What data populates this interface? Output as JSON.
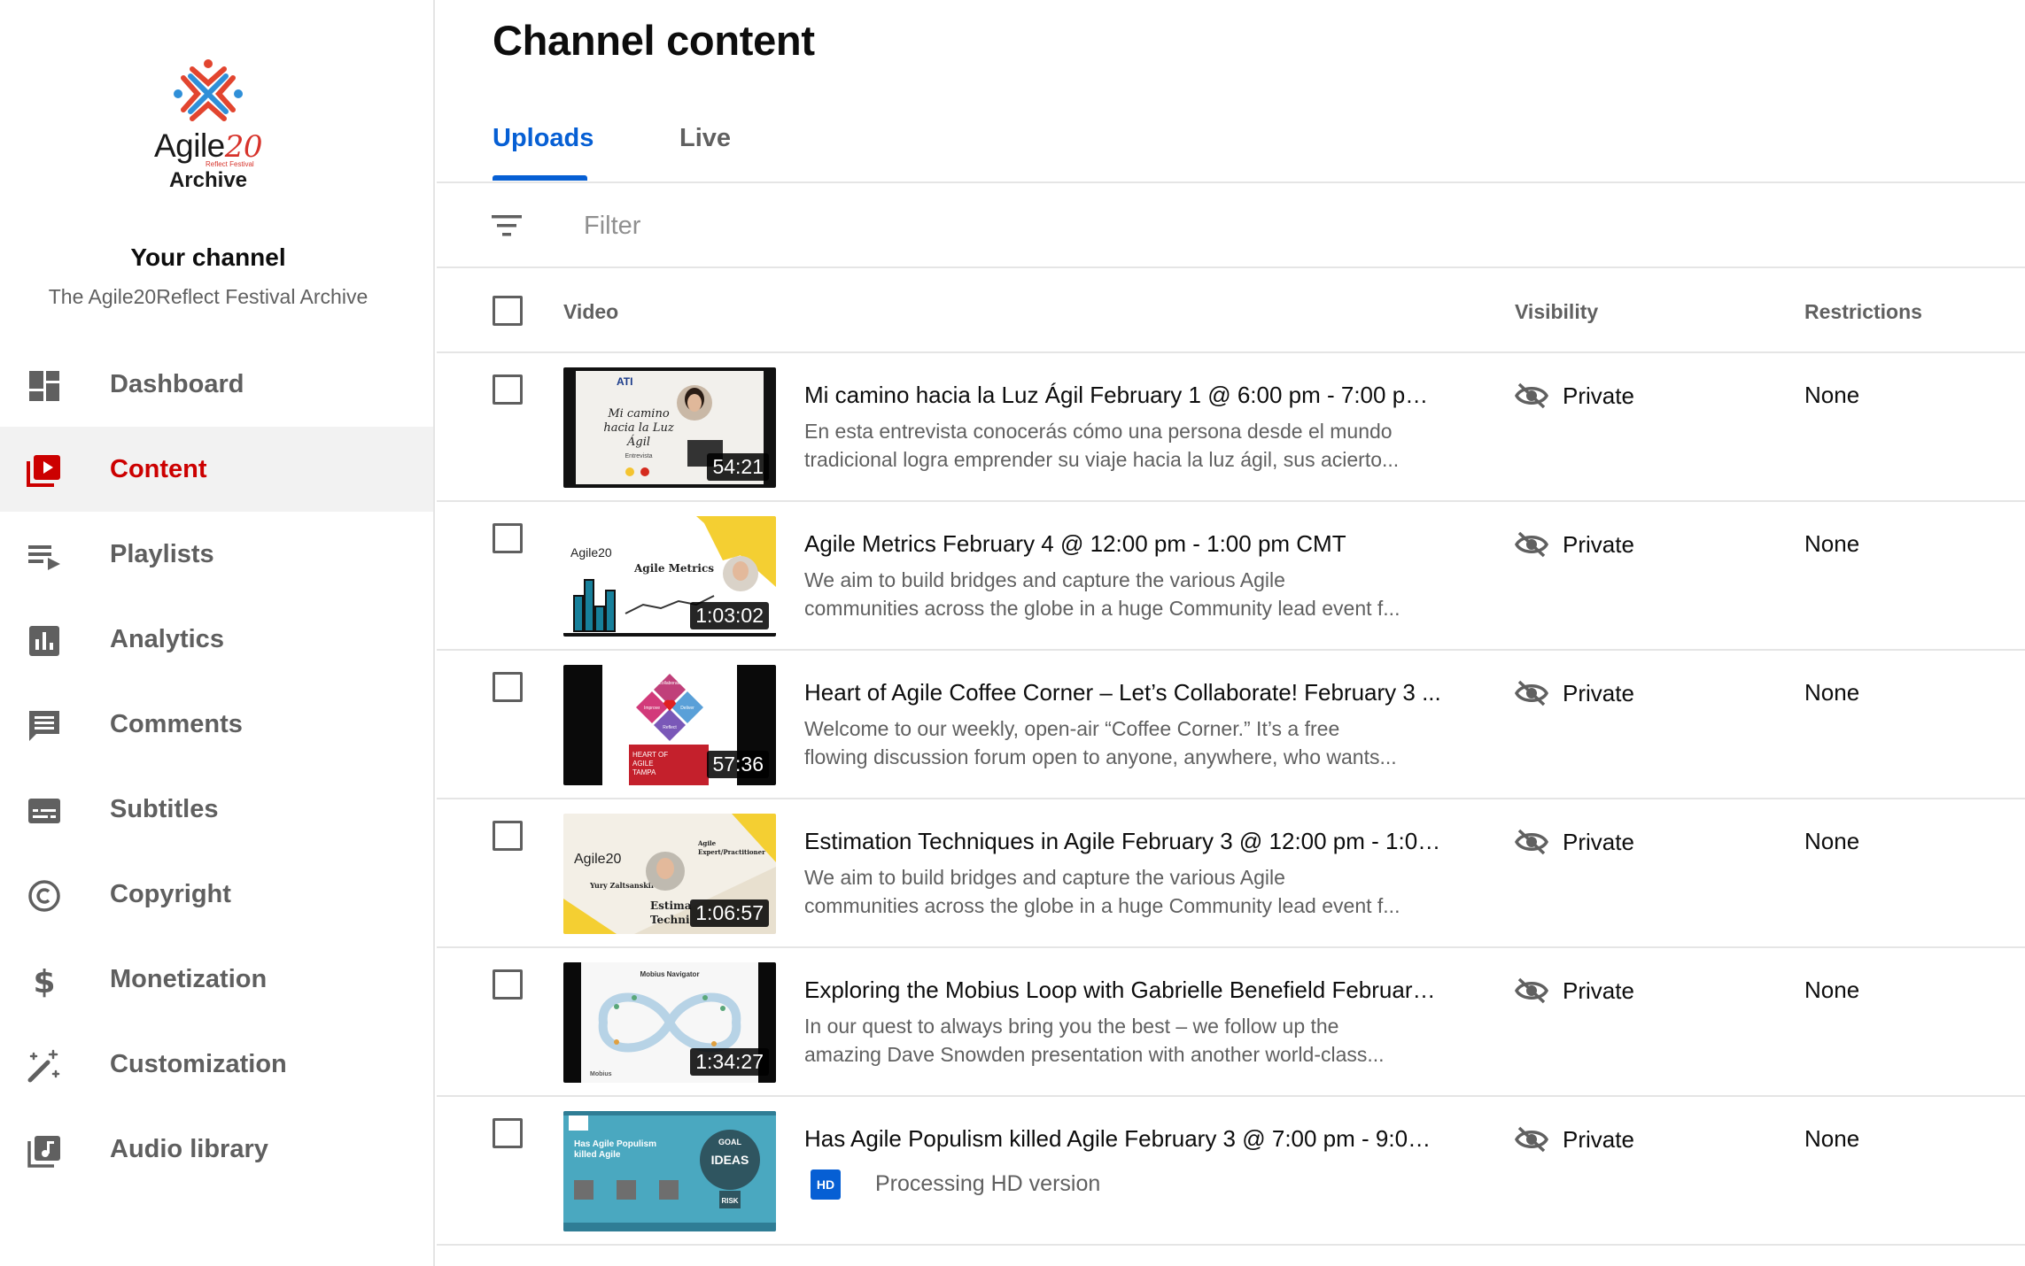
{
  "sidebar": {
    "logo": {
      "word": "Agile",
      "num": "20",
      "tagline": "Reflect Festival",
      "subtitle": "Archive"
    },
    "your_channel": "Your channel",
    "channel_name": "The Agile20Reflect Festival Archive",
    "items": [
      {
        "label": "Dashboard",
        "icon": "dashboard-icon",
        "active": false
      },
      {
        "label": "Content",
        "icon": "content-icon",
        "active": true
      },
      {
        "label": "Playlists",
        "icon": "playlists-icon",
        "active": false
      },
      {
        "label": "Analytics",
        "icon": "analytics-icon",
        "active": false
      },
      {
        "label": "Comments",
        "icon": "comments-icon",
        "active": false
      },
      {
        "label": "Subtitles",
        "icon": "subtitles-icon",
        "active": false
      },
      {
        "label": "Copyright",
        "icon": "copyright-icon",
        "active": false
      },
      {
        "label": "Monetization",
        "icon": "monetization-icon",
        "active": false
      },
      {
        "label": "Customization",
        "icon": "customization-icon",
        "active": false
      },
      {
        "label": "Audio library",
        "icon": "audio-library-icon",
        "active": false
      }
    ]
  },
  "main": {
    "title": "Channel content",
    "tabs": [
      {
        "label": "Uploads",
        "active": true
      },
      {
        "label": "Live",
        "active": false
      }
    ],
    "filter_placeholder": "Filter",
    "columns": {
      "video": "Video",
      "visibility": "Visibility",
      "restrictions": "Restrictions"
    }
  },
  "videos": [
    {
      "title": "Mi camino hacia la Luz Ágil February 1 @ 6:00 pm - 7:00 pm ...",
      "desc1": "En esta entrevista conocerás cómo una persona desde el mundo",
      "desc2": "tradicional logra emprender su viaje hacia la luz ágil, sus acierto...",
      "duration": "54:21",
      "visibility": "Private",
      "restrictions": "None",
      "thumb_text": {
        "brand": "ATI",
        "line1": "Mi camino",
        "line2": "hacia la Luz",
        "line3": "Ágil",
        "line4": "Entrevista"
      }
    },
    {
      "title": "Agile Metrics February 4 @ 12:00 pm - 1:00 pm CMT",
      "desc1": "We aim to build bridges and capture the various Agile",
      "desc2": "communities across the globe in a huge Community lead event f...",
      "duration": "1:03:02",
      "visibility": "Private",
      "restrictions": "None",
      "thumb_text": {
        "caption": "Agile Metrics",
        "logo": "Agile20"
      }
    },
    {
      "title": "Heart of Agile Coffee Corner – Let’s Collaborate! February 3 ...",
      "desc1": "Welcome to our weekly, open-air “Coffee Corner.” It’s a free",
      "desc2": "flowing discussion forum open to anyone, anywhere, who wants...",
      "duration": "57:36",
      "visibility": "Private",
      "restrictions": "None",
      "thumb_text": {
        "line1": "HEART OF",
        "line2": "AGILE",
        "line3": "TAMPA",
        "d1": "Collaborate",
        "d2": "Improve",
        "d3": "Deliver",
        "d4": "Reflect"
      }
    },
    {
      "title": "Estimation Techniques in Agile February 3 @ 12:00 pm - 1:00 ...",
      "desc1": "We aim to build bridges and capture the various Agile",
      "desc2": "communities across the globe in a huge Community lead event f...",
      "duration": "1:06:57",
      "visibility": "Private",
      "restrictions": "None",
      "thumb_text": {
        "logo": "Agile20",
        "speaker": "Yury Zaltsanskii",
        "role1": "Agile",
        "role2": "Expert/Practitioner",
        "topic1": "Estima",
        "topic2": "Techni"
      }
    },
    {
      "title": "Exploring the Mobius Loop with Gabrielle Benefield February ...",
      "desc1": "In our quest to always bring you the best – we follow up the",
      "desc2": "amazing Dave Snowden presentation with another world-class...",
      "duration": "1:34:27",
      "visibility": "Private",
      "restrictions": "None",
      "thumb_text": {
        "caption": "Mobius Navigator",
        "brand": "Mobius"
      }
    },
    {
      "title": "Has Agile Populism killed Agile February 3 @ 7:00 pm - 9:00 ...",
      "processing": "Processing HD version",
      "hd_label": "HD",
      "visibility": "Private",
      "restrictions": "None",
      "thumb_text": {
        "line1": "Has Agile Populism",
        "line2": "killed Agile",
        "bulb1": "GOAL",
        "bulb2": "IDEAS",
        "bulb3": "RISK"
      }
    }
  ],
  "colors": {
    "accent_blue": "#065fd4",
    "active_red": "#cc0000",
    "logo_red": "#d7332b",
    "logo_blue": "#2f8fd8"
  }
}
